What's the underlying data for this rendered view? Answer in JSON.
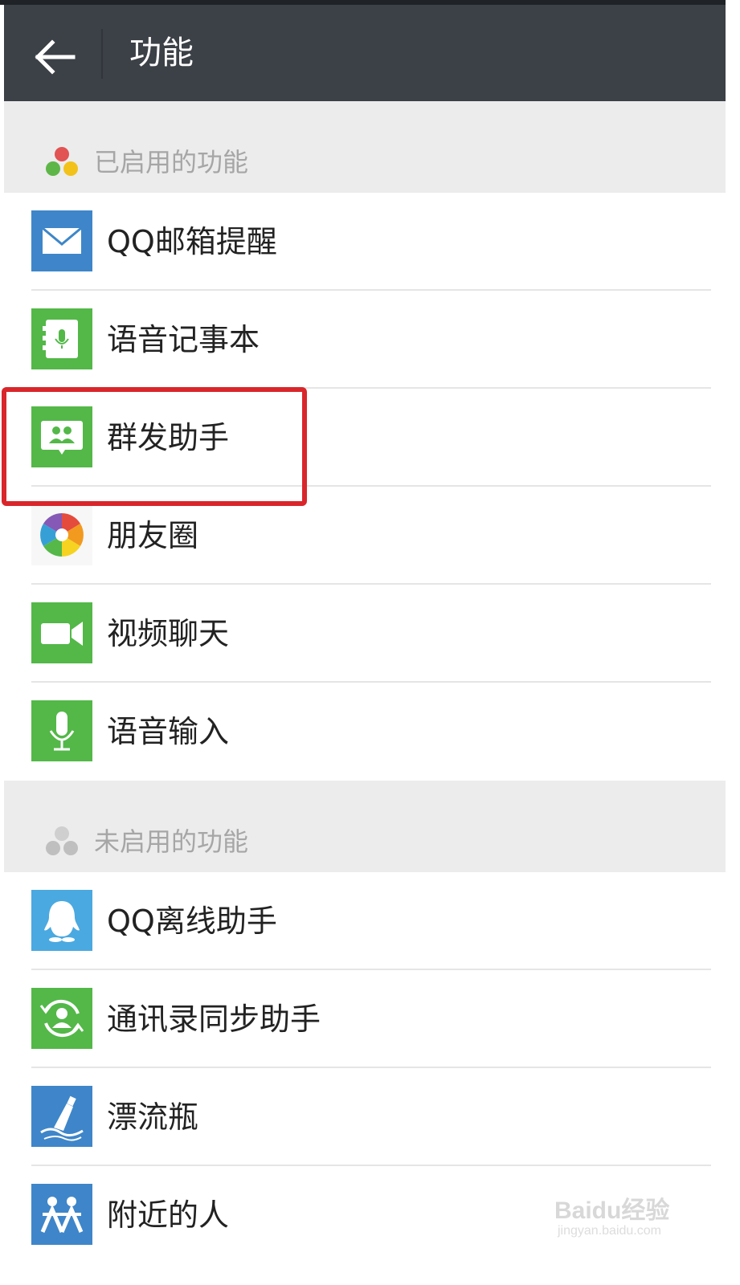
{
  "header": {
    "title": "功能",
    "back_icon": "arrow-left-icon"
  },
  "sections": {
    "enabled": {
      "label": "已启用的功能"
    },
    "disabled": {
      "label": "未启用的功能"
    }
  },
  "enabled_items": [
    {
      "label": "QQ邮箱提醒",
      "icon": "mail-icon"
    },
    {
      "label": "语音记事本",
      "icon": "voice-notebook-icon"
    },
    {
      "label": "群发助手",
      "icon": "group-message-icon"
    },
    {
      "label": "朋友圈",
      "icon": "moments-aperture-icon"
    },
    {
      "label": "视频聊天",
      "icon": "video-camera-icon"
    },
    {
      "label": "语音输入",
      "icon": "microphone-icon"
    }
  ],
  "disabled_items": [
    {
      "label": "QQ离线助手",
      "icon": "qq-penguin-icon"
    },
    {
      "label": "通讯录同步助手",
      "icon": "contact-sync-icon"
    },
    {
      "label": "漂流瓶",
      "icon": "drift-bottle-icon"
    },
    {
      "label": "附近的人",
      "icon": "people-nearby-icon"
    }
  ],
  "watermark": {
    "brand": "Baidu经验",
    "url": "jingyan.baidu.com"
  },
  "colors": {
    "header_bg": "#3c4047",
    "section_bg": "#ececec",
    "icon_green": "#53b848",
    "icon_blue": "#3e86c9",
    "icon_light_blue": "#4aa9e0",
    "highlight": "#d9262b"
  }
}
